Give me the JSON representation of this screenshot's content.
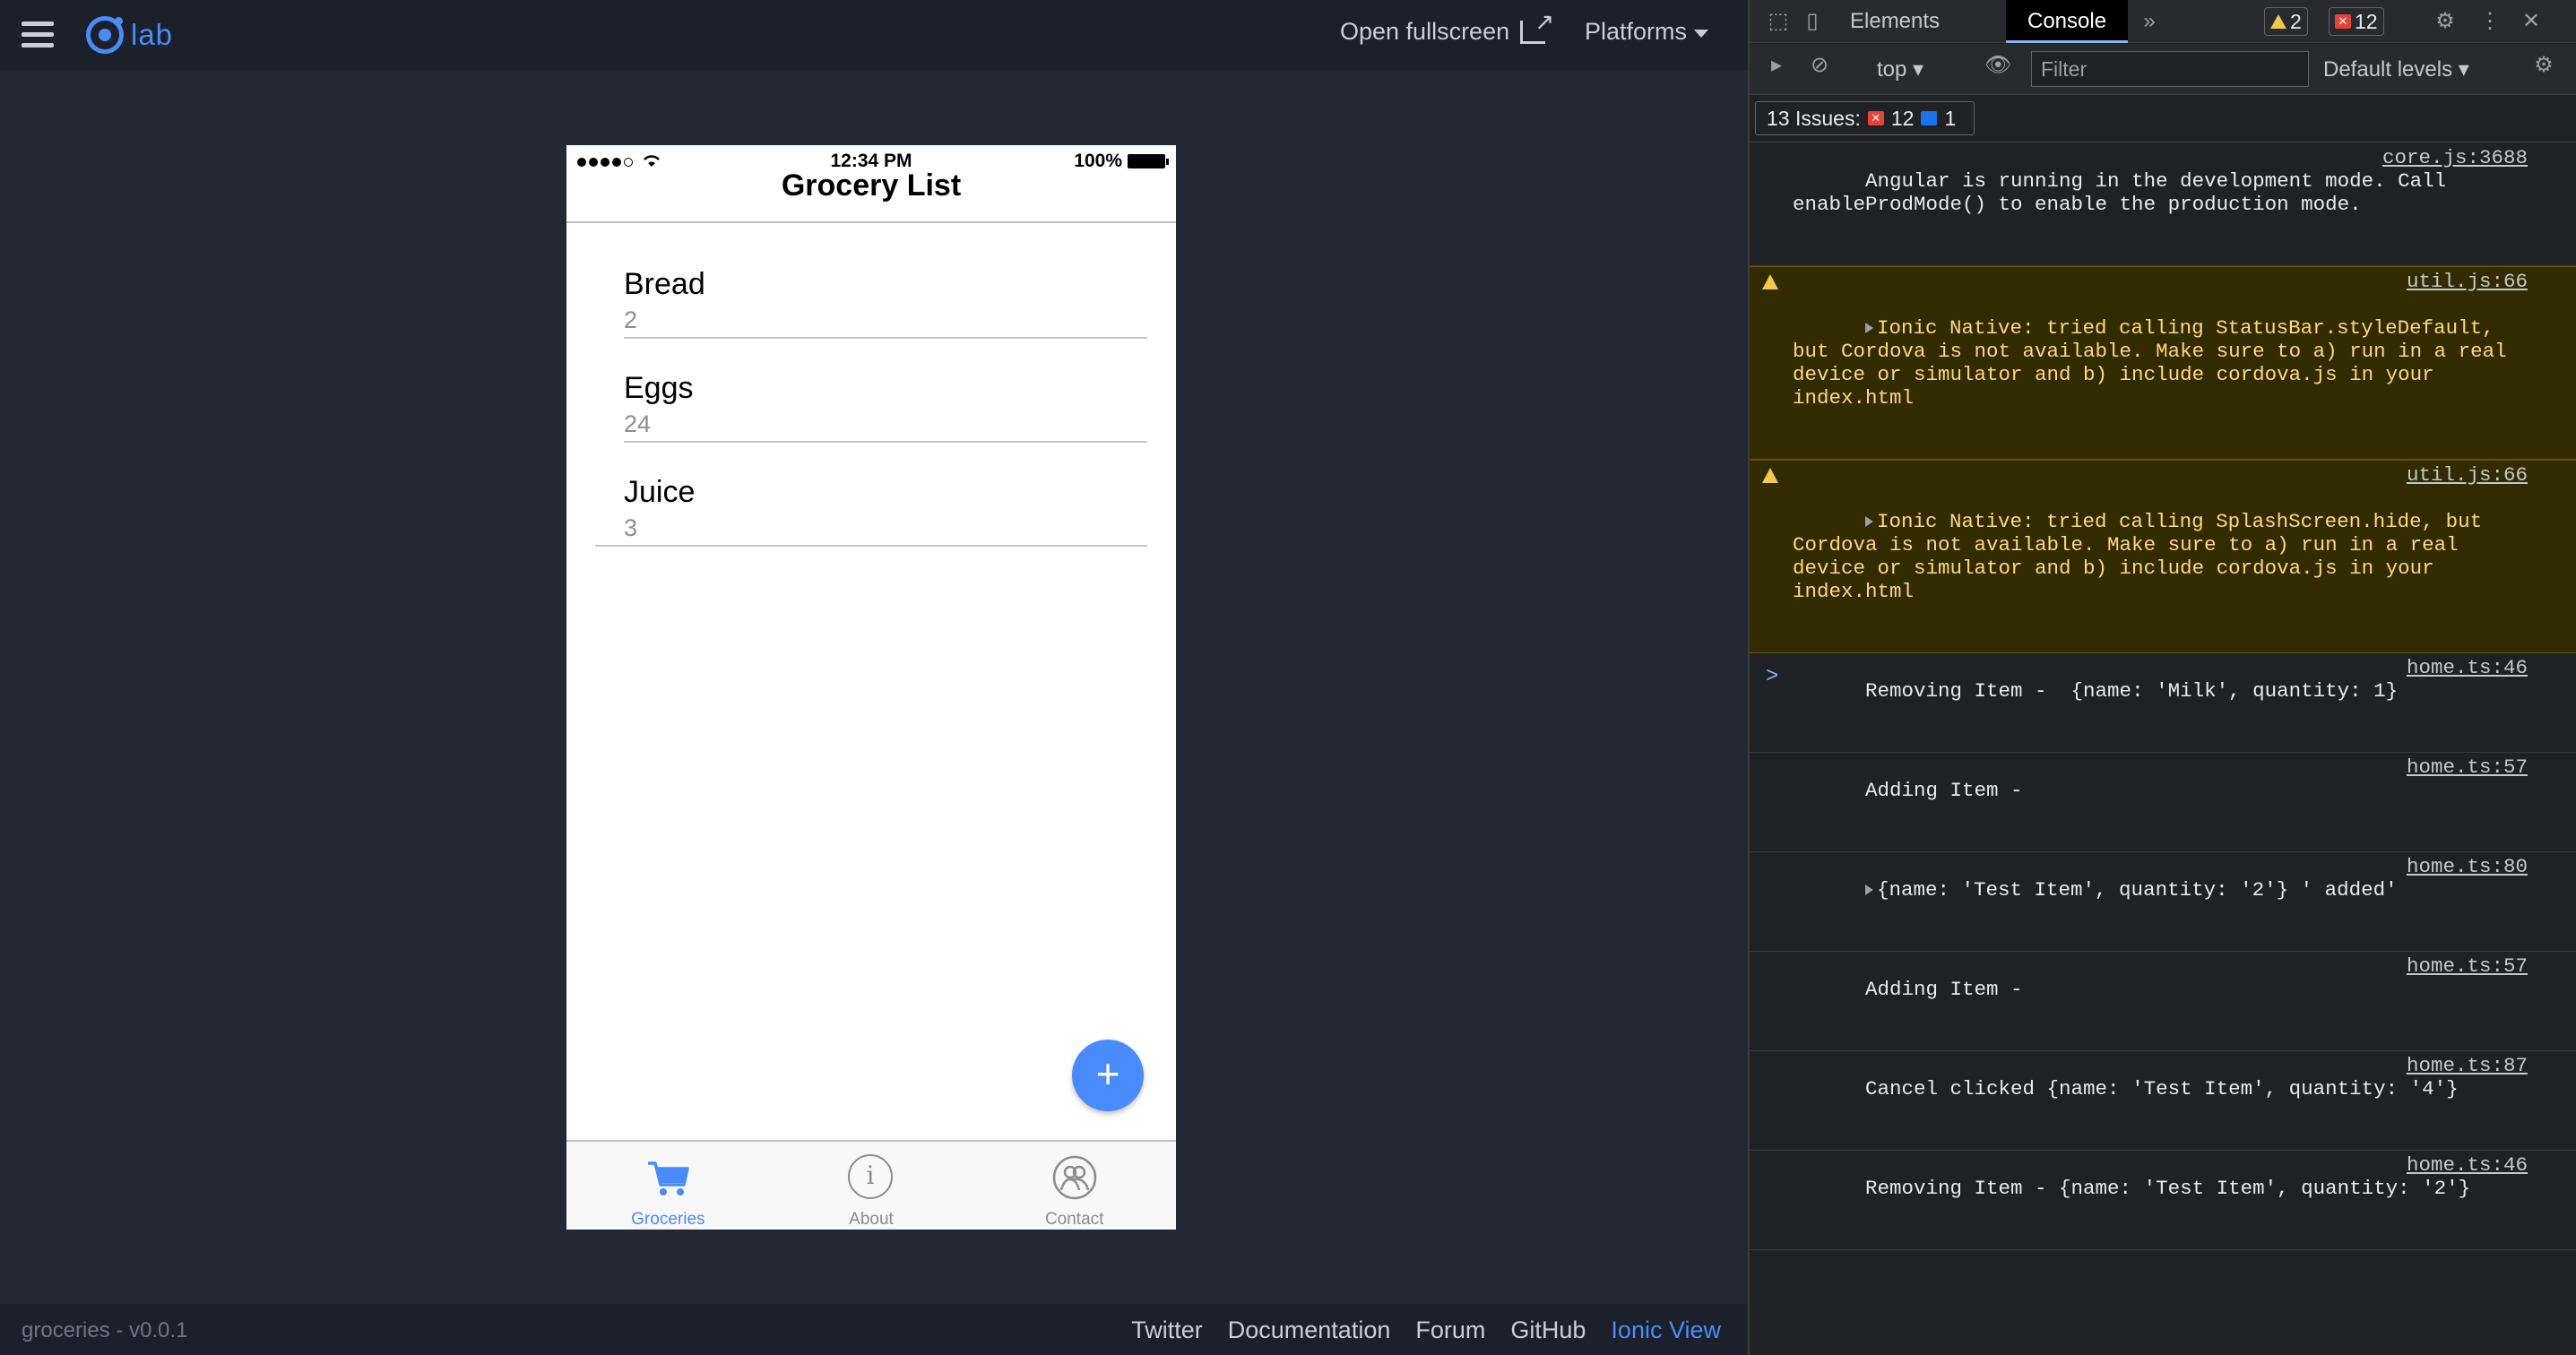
{
  "lab": {
    "logo_text": "lab",
    "open_fullscreen": "Open fullscreen",
    "platforms": "Platforms",
    "footer_version": "groceries - v0.0.1",
    "footer_links": [
      "Twitter",
      "Documentation",
      "Forum",
      "GitHub",
      "Ionic View"
    ],
    "accent_color": "#4a8bfc"
  },
  "phone": {
    "status_time": "12:34 PM",
    "battery_label": "100%",
    "title": "Grocery List",
    "items": [
      {
        "name": "Bread",
        "quantity": "2"
      },
      {
        "name": "Eggs",
        "quantity": "24"
      },
      {
        "name": "Juice",
        "quantity": "3"
      }
    ],
    "fab_label": "+",
    "tabs": [
      {
        "label": "Groceries",
        "icon": "cart-icon",
        "active": true
      },
      {
        "label": "About",
        "icon": "info-icon",
        "active": false
      },
      {
        "label": "Contact",
        "icon": "contacts-icon",
        "active": false
      }
    ]
  },
  "devtools": {
    "tabs": [
      "Elements",
      "Console"
    ],
    "active_tab": "Console",
    "more_tabs": "»",
    "warning_count": "2",
    "error_count": "12",
    "context": "top",
    "filter_placeholder": "Filter",
    "levels": "Default levels",
    "issues_label": "13 Issues:",
    "issues_errors": "12",
    "issues_info": "1",
    "messages": [
      {
        "type": "log",
        "source": "core.js:3688",
        "text": "Angular is running in the development mode. Call enableProdMode() to enable the production mode."
      },
      {
        "type": "warn",
        "source": "util.js:66",
        "text": "Ionic Native: tried calling StatusBar.styleDefault, but Cordova is not available. Make sure to a) run in a real device or simulator and b) include cordova.js in your index.html"
      },
      {
        "type": "warn",
        "source": "util.js:66",
        "text": "Ionic Native: tried calling SplashScreen.hide, but Cordova is not available. Make sure to a) run in a real device or simulator and b) include cordova.js in your index.html"
      },
      {
        "type": "log",
        "source": "home.ts:46",
        "text": "Removing Item -  {name: 'Milk', quantity: 1}"
      },
      {
        "type": "log",
        "source": "home.ts:57",
        "text": "Adding Item -"
      },
      {
        "type": "log",
        "source": "home.ts:80",
        "text": "{name: 'Test Item', quantity: '2'} ' added'"
      },
      {
        "type": "log",
        "source": "home.ts:57",
        "text": "Adding Item -"
      },
      {
        "type": "log",
        "source": "home.ts:87",
        "text": "Cancel clicked {name: 'Test Item', quantity: '4'}"
      },
      {
        "type": "log",
        "source": "home.ts:46",
        "text": "Removing Item - {name: 'Test Item', quantity: '2'}"
      }
    ],
    "prompt": ">"
  }
}
